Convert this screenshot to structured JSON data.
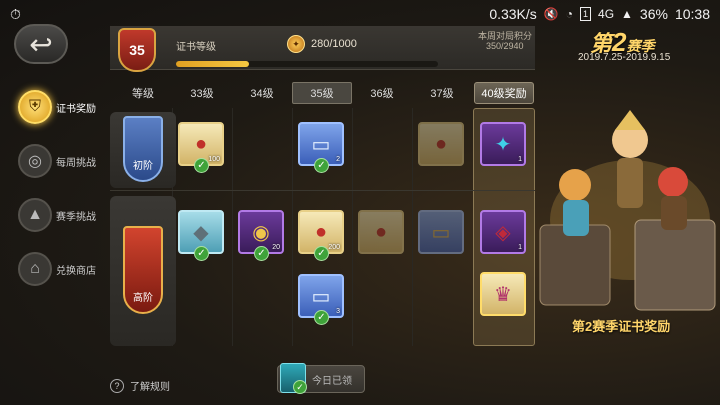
{
  "status_bar": {
    "speed": "0.33K/s",
    "network": "4G",
    "battery": "36%",
    "time": "10:38",
    "sim_box": "1"
  },
  "header": {
    "level": "35",
    "title": "证书等级",
    "xp_text": "280/1000",
    "xp_progress": 0.28,
    "weekly_label": "本周对局积分",
    "weekly_value": "350/2940"
  },
  "season": {
    "title_prefix": "第",
    "number": "2",
    "title_suffix": "赛季",
    "dates": "2019.7.25-2019.9.15",
    "reward_caption": "第2赛季证书奖励"
  },
  "sidebar": {
    "items": [
      {
        "label": "证书奖励",
        "icon": "shield-icon",
        "active": true
      },
      {
        "label": "每周挑战",
        "icon": "target-icon",
        "active": false
      },
      {
        "label": "赛季挑战",
        "icon": "mountain-icon",
        "active": false
      },
      {
        "label": "兑换商店",
        "icon": "shop-icon",
        "active": false
      }
    ]
  },
  "tabs": {
    "header": "等级",
    "levels": [
      "33级",
      "34级",
      "35级",
      "36级",
      "37级"
    ],
    "active": "35级",
    "reward_tab": "40级奖励"
  },
  "tiers": {
    "basic": "初阶",
    "advanced": "高阶"
  },
  "rewards": {
    "basic": [
      {
        "level": "33级",
        "item": "red-egg-icon",
        "count": "100",
        "claimed": true
      },
      {
        "level": "35级",
        "item": "blue-ticket-icon",
        "count": "2",
        "claimed": true
      },
      {
        "level": "37级",
        "item": "red-egg-icon",
        "count": "",
        "claimed": false
      },
      {
        "level": "40级",
        "item": "purple-cape-icon",
        "count": "1",
        "claimed": false
      }
    ],
    "advanced": [
      {
        "level": "33级",
        "item": "hippo-icon",
        "count": "",
        "claimed": true
      },
      {
        "level": "34级",
        "item": "lion-coin-icon",
        "count": "20",
        "claimed": true
      },
      {
        "level": "35级",
        "item": "red-egg-icon",
        "count": "200",
        "claimed": true
      },
      {
        "level": "35级",
        "item": "blue-ticket-icon",
        "count": "3",
        "claimed": true
      },
      {
        "level": "36级",
        "item": "red-egg-icon",
        "count": "",
        "claimed": false
      },
      {
        "level": "37级",
        "item": "gold-ticket-icon",
        "count": "",
        "claimed": false
      },
      {
        "level": "40级",
        "item": "demon-mask-icon",
        "count": "1",
        "claimed": false
      },
      {
        "level": "40级",
        "item": "crown-icon",
        "count": "",
        "claimed": false
      }
    ]
  },
  "bottom": {
    "rules": "了解规则",
    "claim_status": "今日已领"
  }
}
